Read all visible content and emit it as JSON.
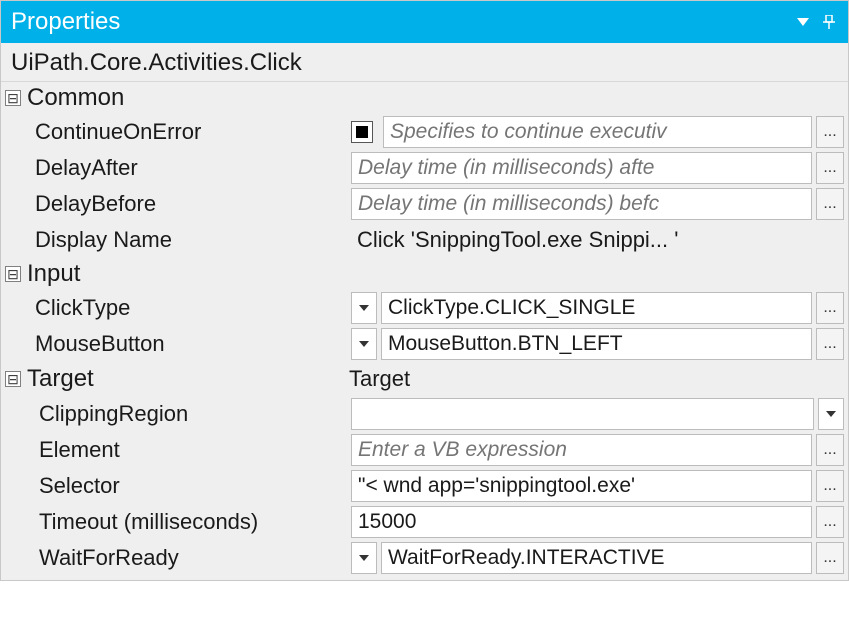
{
  "header": {
    "title": "Properties"
  },
  "class_name": "UiPath.Core.Activities.Click",
  "categories": {
    "common": {
      "label": "Common",
      "continue_on_error": {
        "label": "ContinueOnError",
        "placeholder": "Specifies to continue executiv"
      },
      "delay_after": {
        "label": "DelayAfter",
        "placeholder": "Delay time (in milliseconds) afte"
      },
      "delay_before": {
        "label": "DelayBefore",
        "placeholder": "Delay time (in milliseconds) befc"
      },
      "display_name": {
        "label": "Display Name",
        "value": "Click 'SnippingTool.exe Snippi... '"
      }
    },
    "input": {
      "label": "Input",
      "click_type": {
        "label": "ClickType",
        "value": "ClickType.CLICK_SINGLE"
      },
      "mouse_button": {
        "label": "MouseButton",
        "value": "MouseButton.BTN_LEFT"
      }
    },
    "target": {
      "label": "Target",
      "value": "Target",
      "clipping_region": {
        "label": "ClippingRegion",
        "value": ""
      },
      "element": {
        "label": "Element",
        "placeholder": "Enter a VB expression"
      },
      "selector": {
        "label": "Selector",
        "value": "\"< wnd app='snippingtool.exe' "
      },
      "timeout": {
        "label": "Timeout (milliseconds)",
        "value": "15000"
      },
      "wait_for_ready": {
        "label": "WaitForReady",
        "value": "WaitForReady.INTERACTIVE"
      }
    }
  },
  "glyphs": {
    "ellipsis": "..."
  }
}
